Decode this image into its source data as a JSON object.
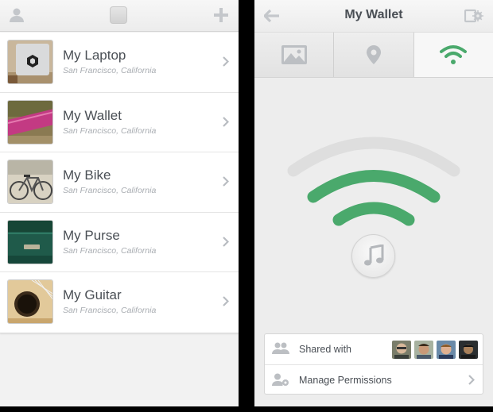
{
  "left": {
    "items": [
      {
        "title": "My Laptop",
        "location": "San Francisco, California",
        "thumb": "laptop-photo"
      },
      {
        "title": "My Wallet",
        "location": "San Francisco, California",
        "thumb": "wallet-photo"
      },
      {
        "title": "My Bike",
        "location": "San Francisco, California",
        "thumb": "bike-photo"
      },
      {
        "title": "My Purse",
        "location": "San Francisco, California",
        "thumb": "purse-photo"
      },
      {
        "title": "My Guitar",
        "location": "San Francisco, California",
        "thumb": "guitar-photo"
      }
    ],
    "icons": [
      "user-icon",
      "photo-chip-icon",
      "plus-icon",
      "chevron-right-icon"
    ]
  },
  "right": {
    "title": "My Wallet",
    "tabs": [
      {
        "icon": "image-icon",
        "active": false
      },
      {
        "icon": "location-pin-icon",
        "active": false
      },
      {
        "icon": "wifi-signal-icon",
        "active": true
      }
    ],
    "shared_label": "Shared with",
    "manage_label": "Manage Permissions",
    "avatar_count": 4
  },
  "colors": {
    "accent_green": "#4aa96c",
    "text": "#4a4f55",
    "subtext": "#a9adb2",
    "icon_gray": "#c4c7cb",
    "bg": "#f2f2f2"
  }
}
